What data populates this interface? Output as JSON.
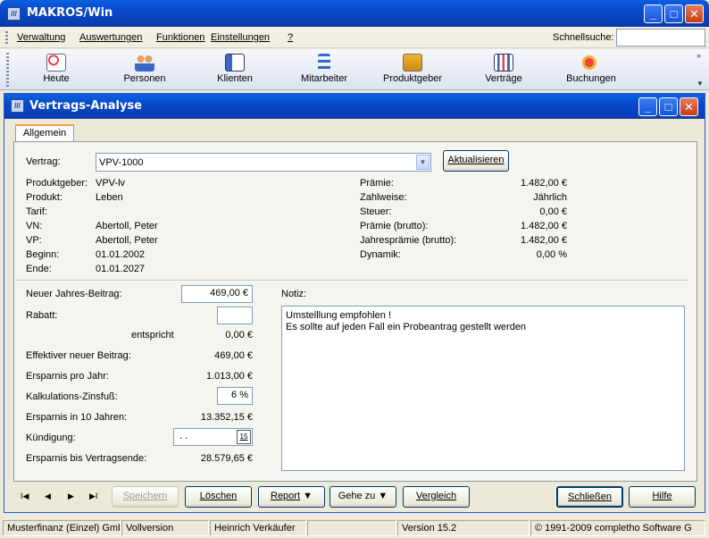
{
  "app": {
    "title": "MAKROS/Win",
    "icon": "app-logo-icon"
  },
  "menu": {
    "items": [
      "Verwaltung",
      "Auswertungen",
      "Funktionen",
      "Einstellungen",
      "?"
    ],
    "search_label": "Schnellsuche:",
    "search_value": ""
  },
  "toolbar": {
    "buttons": [
      {
        "label": "Heute",
        "icon": "calendar-clock-icon"
      },
      {
        "label": "Personen",
        "icon": "people-icon"
      },
      {
        "label": "Klienten",
        "icon": "client-card-icon"
      },
      {
        "label": "Mitarbeiter",
        "icon": "org-tree-icon"
      },
      {
        "label": "Produktgeber",
        "icon": "product-boxes-icon"
      },
      {
        "label": "Verträge",
        "icon": "contracts-chart-icon"
      },
      {
        "label": "Buchungen",
        "icon": "bookings-icon"
      }
    ]
  },
  "window": {
    "title": "Vertrags-Analyse",
    "tab": "Allgemein"
  },
  "contract": {
    "label": "Vertrag:",
    "value": "VPV-1000",
    "refresh_label": "Aktualisieren"
  },
  "details_left": [
    {
      "label": "Produktgeber:",
      "value": "VPV-lv"
    },
    {
      "label": "Produkt:",
      "value": "Leben"
    },
    {
      "label": "Tarif:",
      "value": ""
    },
    {
      "label": "VN:",
      "value": "Abertoll, Peter"
    },
    {
      "label": "VP:",
      "value": "Abertoll, Peter"
    },
    {
      "label": "Beginn:",
      "value": "01.01.2002"
    },
    {
      "label": "Ende:",
      "value": "01.01.2027"
    }
  ],
  "details_right": [
    {
      "label": "Prämie:",
      "value": "1.482,00 €"
    },
    {
      "label": "Zahlweise:",
      "value": "Jährlich"
    },
    {
      "label": "Steuer:",
      "value": "0,00 €"
    },
    {
      "label": "Prämie (brutto):",
      "value": "1.482,00 €"
    },
    {
      "label": "Jahresprämie (brutto):",
      "value": "1.482,00 €"
    },
    {
      "label": "Dynamik:",
      "value": "0,00 %"
    }
  ],
  "calc": {
    "new_annual_label": "Neuer Jahres-Beitrag:",
    "new_annual_value": "469,00 €",
    "discount_label": "Rabatt:",
    "discount_value": "",
    "equivalent_label": "entspricht",
    "equivalent_value": "0,00 €",
    "effective_label": "Effektiver neuer Beitrag:",
    "effective_value": "469,00 €",
    "savings_year_label": "Ersparnis pro Jahr:",
    "savings_year_value": "1.013,00 €",
    "interest_label": "Kalkulations-Zinsfuß:",
    "interest_value": "6 %",
    "savings_10_label": "Ersparnis in 10 Jahren:",
    "savings_10_value": "13.352,15 €",
    "termination_label": "Kündigung:",
    "termination_value": " .  .",
    "calendar_label": "15",
    "savings_end_label": "Ersparnis bis Vertragsende:",
    "savings_end_value": "28.579,65 €"
  },
  "note": {
    "label": "Notiz:",
    "line1": "Umstelllung empfohlen !",
    "line2": "Es sollte auf jeden Fall ein Probeantrag gestellt werden"
  },
  "nav": {
    "first": "I◀",
    "prev": "◀",
    "next": "▶",
    "last": "▶I"
  },
  "actions": {
    "save": "Speichern",
    "delete": "Löschen",
    "report": "Report",
    "goto": "Gehe zu",
    "compare": "Vergleich",
    "close": "Schließen",
    "help": "Hilfe"
  },
  "status": {
    "company": "Musterfinanz (Einzel) Gmb",
    "edition": "Vollversion",
    "user": "Heinrich Verkäufer",
    "empty": "",
    "version": "Version 15.2",
    "copyright": "© 1991-2009 completho Software G"
  }
}
